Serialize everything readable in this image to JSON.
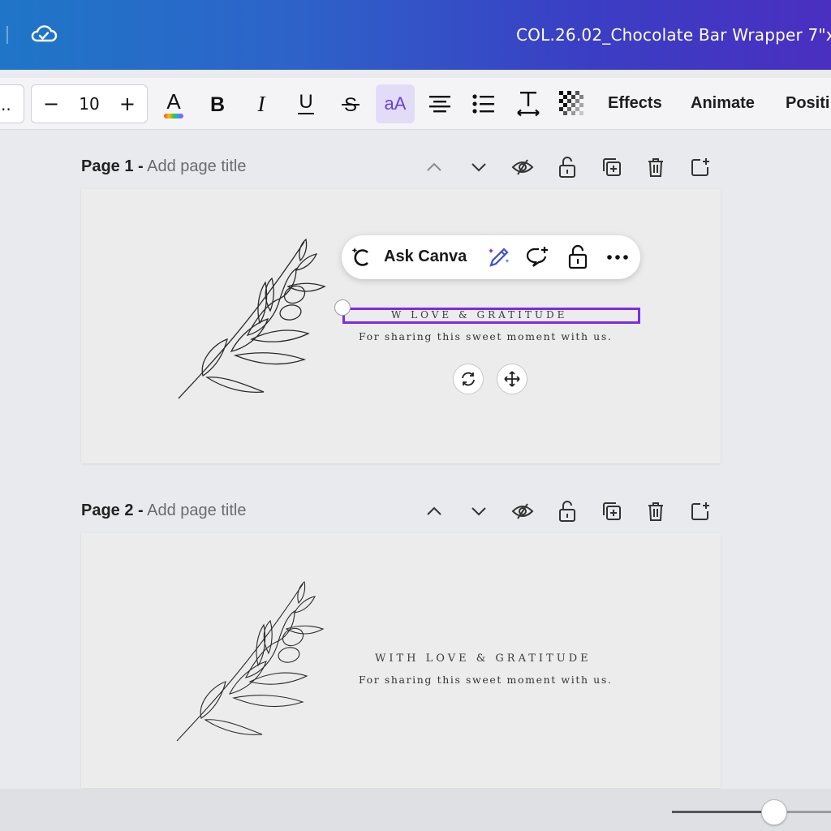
{
  "topbar": {
    "doc_title": "COL.26.02_Chocolate Bar Wrapper 7\"x",
    "icons": [
      "cloud-sync-icon"
    ]
  },
  "toolbar": {
    "font_name": "..",
    "font_size": "10",
    "decrease": "−",
    "increase": "+",
    "case_label": "aA",
    "effects_label": "Effects",
    "animate_label": "Animate",
    "position_label": "Positi"
  },
  "pages": [
    {
      "label": "Page 1 -",
      "title_placeholder": "Add page title",
      "heading": "W LOVE & GRATITUDE",
      "subtext": "For sharing this sweet moment with us."
    },
    {
      "label": "Page 2 -",
      "title_placeholder": "Add page title",
      "heading": "WITH LOVE & GRATITUDE",
      "subtext": "For sharing this sweet moment with us."
    }
  ],
  "ask_canva": {
    "label": "Ask Canva"
  },
  "colors": {
    "selection": "#7d2ae8",
    "accent": "#6b3fd6",
    "topbar_start": "#1f76c8",
    "topbar_end": "#4a2fc0"
  },
  "zoom": {
    "slider_value": 0.64
  }
}
